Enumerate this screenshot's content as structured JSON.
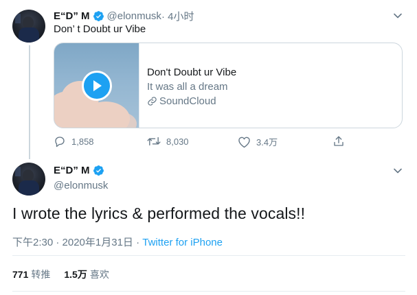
{
  "first_tweet": {
    "display_name": "E“D” M",
    "handle": "@elonmusk",
    "time": " · 4小时",
    "text": "Don’ t Doubt ur Vibe",
    "card": {
      "title": "Don't Doubt ur Vibe",
      "description": "It was all a dream",
      "domain": "SoundCloud"
    },
    "actions": {
      "replies": "1,858",
      "retweets": "8,030",
      "likes": "3.4万"
    }
  },
  "main_tweet": {
    "display_name": "E“D” M",
    "handle": "@elonmusk",
    "text": "I wrote the lyrics & performed the vocals!!",
    "timestamp": "下午2:30 · 2020年1月31日 · ",
    "source": "Twitter for iPhone",
    "stats": {
      "retweet_count": "771",
      "retweet_label": "转推",
      "like_count": "1.5万",
      "like_label": "喜欢"
    }
  },
  "colors": {
    "accent": "#1da1f2",
    "secondary_text": "#657786",
    "border": "#ccd6dd"
  },
  "icons": [
    "avatar",
    "verified-badge-icon",
    "chevron-down-icon",
    "play-icon",
    "link-icon",
    "reply-icon",
    "retweet-icon",
    "like-icon",
    "share-icon"
  ]
}
